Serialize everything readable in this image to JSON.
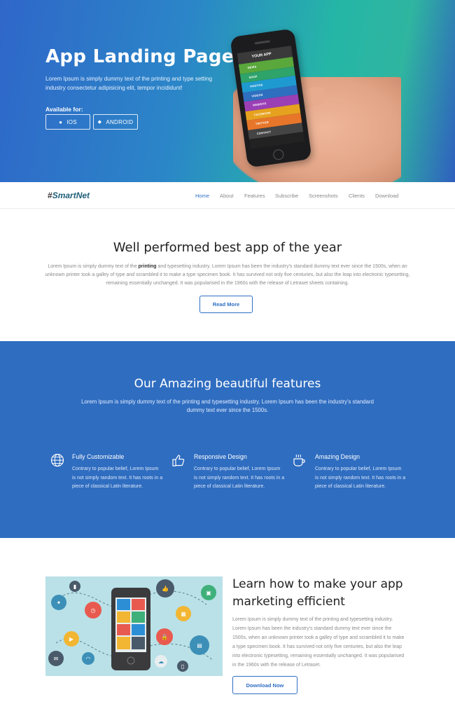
{
  "hero": {
    "title": "App Landing Page",
    "subtitle": "Lorem Ipsum is simply dummy text of the printing and type setting industry consectetur adipisicing elit, tempor incididunt!",
    "available_label": "Available for:",
    "ios_label": "IOS",
    "android_label": "ANDROID",
    "phone": {
      "header": "YOUR APP",
      "items": [
        {
          "label": "NEWS",
          "color": "#5aa83c"
        },
        {
          "label": "SHOP",
          "color": "#2ea36a"
        },
        {
          "label": "PHOTOS",
          "color": "#1f9ad1"
        },
        {
          "label": "VIDEOS",
          "color": "#2f6fc0"
        },
        {
          "label": "WEBSITE",
          "color": "#9b3fb5"
        },
        {
          "label": "FACEBOOK",
          "color": "#e6a21f"
        },
        {
          "label": "TWITTER",
          "color": "#e7762a"
        },
        {
          "label": "CONTACT",
          "color": "#444444"
        }
      ]
    }
  },
  "nav": {
    "logo_hash": "#",
    "logo_text": "SmartNet",
    "items": [
      "Home",
      "About",
      "Features",
      "Subscribe",
      "Screenshots",
      "Clients",
      "Download"
    ]
  },
  "intro": {
    "title": "Well performed best app of the year",
    "text_before": "Lorem Ipsum is simply dummy text of the ",
    "text_bold": "printing",
    "text_after": " and typesetting industry. Lorem Ipsum has been the industry's standard dummy text ever since the 1500s, when an unknown printer took a galley of type and scrambled it to make a type specimen book. It has survived not only five centuries, but also the leap into electronic typesetting, remaining essentially unchanged. It was popularised in the 1960s with the release of Letraset sheets containing.",
    "button": "Read More"
  },
  "features": {
    "title": "Our Amazing beautiful features",
    "text": "Lorem Ipsum is simply dummy text of the printing and typesetting industry. Lorem Ipsum has been the industry's standard dummy text ever since the 1500s.",
    "items": [
      {
        "title": "Fully Customizable",
        "text": "Contrary to popular belief, Lorem Ipsum is not simply random text. It has roots in a piece of classical Latin literature.",
        "icon": "globe-icon"
      },
      {
        "title": "Responsive Design",
        "text": "Contrary to popular belief, Lorem Ipsum is not simply random text. It has roots in a piece of classical Latin literature.",
        "icon": "thumbs-up-icon"
      },
      {
        "title": "Amazing Design",
        "text": "Contrary to popular belief, Lorem Ipsum is not simply random text. It has roots in a piece of classical Latin literature.",
        "icon": "coffee-cup-icon"
      }
    ]
  },
  "marketing": {
    "title": "Learn how to make your app marketing efficient",
    "text": "Lorem Ipsum is simply dummy text of the printing and typesetting industry. Lorem Ipsum has been the industry's standard dummy text ever since the 1500s, when an unknown printer took a galley of type and scrambled it to make a type specimen book. It has survived not only five centuries, but also the leap into electronic typesetting, remaining essentially unchanged. It was popularised in the 1960s with the release of Letraset.",
    "button": "Download Now"
  },
  "colors": {
    "accent": "#2e6fc4",
    "features_bg": "#2f6dc0"
  }
}
